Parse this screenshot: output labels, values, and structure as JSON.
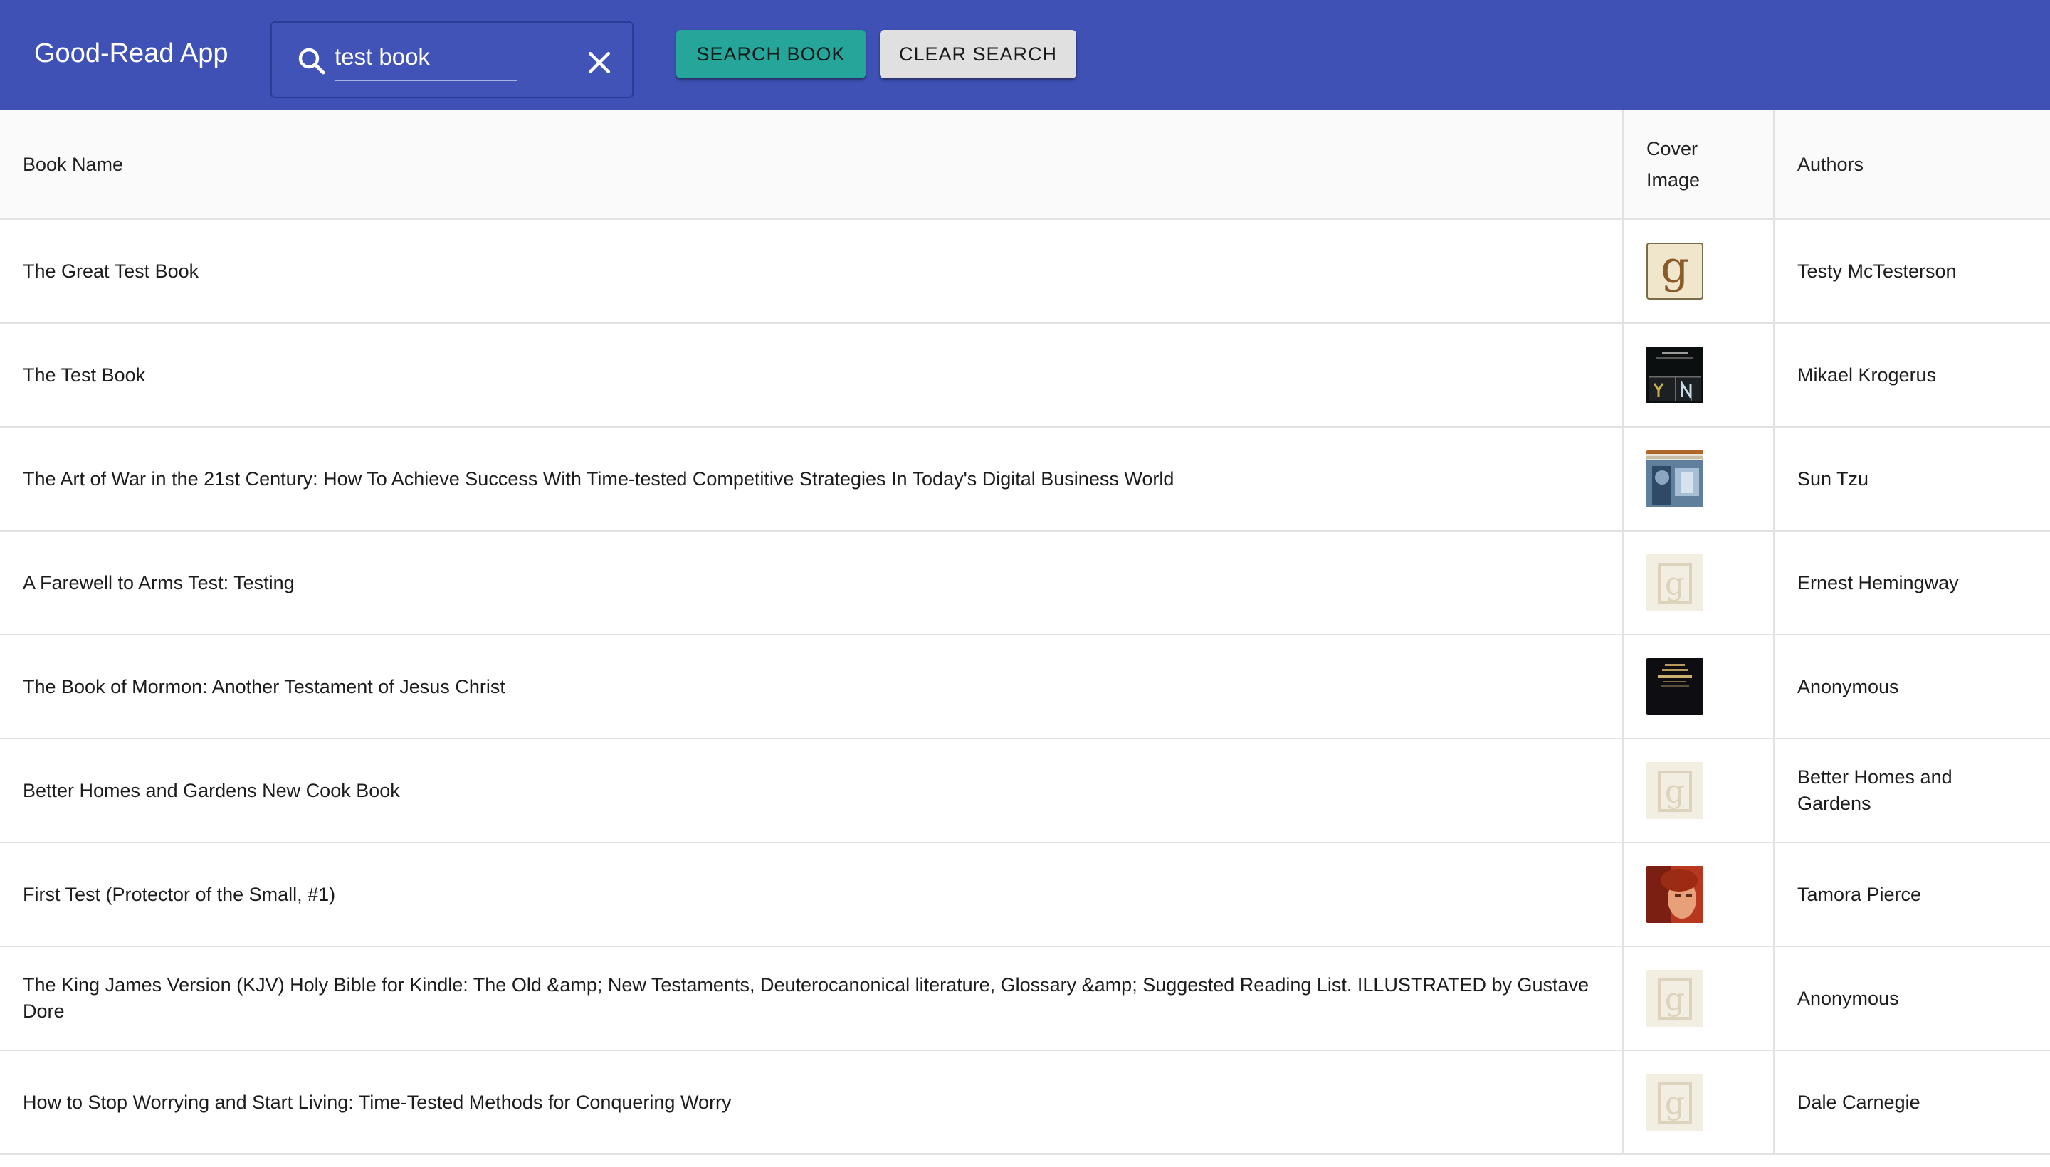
{
  "app": {
    "title": "Good-Read App"
  },
  "search": {
    "value": "test book",
    "search_button_label": "Search Book",
    "clear_button_label": "Clear Search"
  },
  "table": {
    "headers": {
      "name": "Book Name",
      "cover": "Cover Image",
      "authors": "Authors"
    },
    "rows": [
      {
        "name": "The Great Test Book",
        "author": "Testy McTesterson",
        "cover": "goodreads-g-placeholder"
      },
      {
        "name": "The Test Book",
        "author": "Mikael Krogerus",
        "cover": "dark-cover-yn"
      },
      {
        "name": "The Art of War in the 21st Century: How To Achieve Success With Time-tested Competitive Strategies In Today's Digital Business World",
        "author": "Sun Tzu",
        "cover": "blue-photo-cover"
      },
      {
        "name": "A Farewell to Arms Test: Testing",
        "author": "Ernest Hemingway",
        "cover": "faded-g-placeholder"
      },
      {
        "name": "The Book of Mormon: Another Testament of Jesus Christ",
        "author": "Anonymous",
        "cover": "dark-book-cover"
      },
      {
        "name": "Better Homes and Gardens New Cook Book",
        "author": "Better Homes and Gardens",
        "cover": "faded-g-placeholder"
      },
      {
        "name": "First Test (Protector of the Small, #1)",
        "author": "Tamora Pierce",
        "cover": "red-portrait-cover"
      },
      {
        "name": "The King James Version (KJV) Holy Bible for Kindle: The Old &amp; New Testaments, Deuterocanonical literature, Glossary &amp; Suggested Reading List. ILLUSTRATED by Gustave Dore",
        "author": "Anonymous",
        "cover": "faded-g-placeholder"
      },
      {
        "name": "How to Stop Worrying and Start Living: Time-Tested Methods for Conquering Worry",
        "author": "Dale Carnegie",
        "cover": "faded-g-placeholder"
      }
    ]
  },
  "colors": {
    "appbar": "#3f51b5",
    "search_button": "#26a69a",
    "clear_button": "#e0e0e0"
  }
}
